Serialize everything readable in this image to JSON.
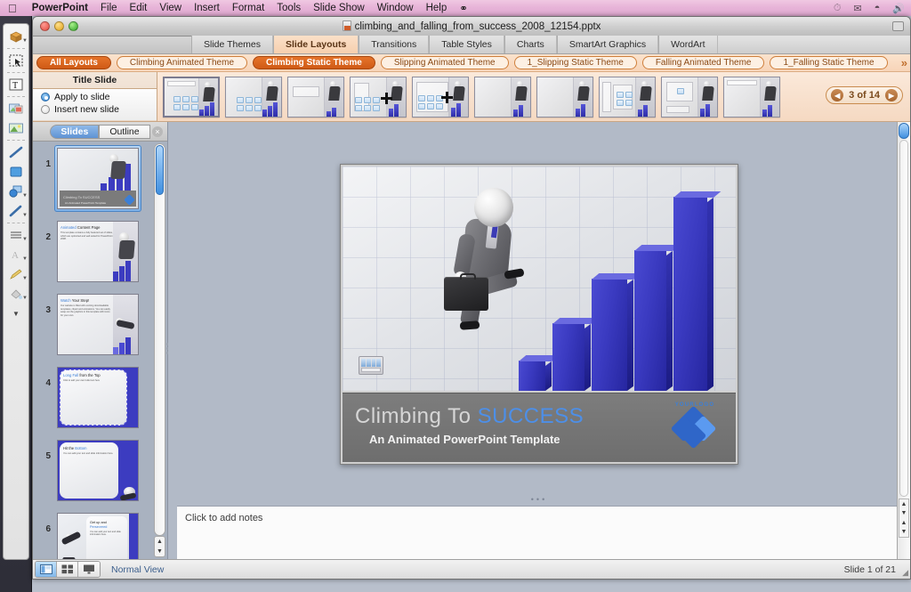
{
  "menubar": {
    "apple_icon": "apple-logo",
    "items": [
      "PowerPoint",
      "File",
      "Edit",
      "View",
      "Insert",
      "Format",
      "Tools",
      "Slide Show",
      "Window",
      "Help"
    ],
    "app_name": "PowerPoint",
    "extra_icon": "script-menu-icon",
    "status_icons": [
      "clock-icon",
      "bluetooth-icon",
      "wifi-icon",
      "volume-icon"
    ]
  },
  "window": {
    "title": "climbing_and_falling_from_success_2008_12154.pptx",
    "doc_icon": "pptx-file-icon",
    "close_label": "close",
    "minimize_label": "minimize",
    "zoom_label": "zoom"
  },
  "ribbon": {
    "tabs": [
      {
        "label": "Slide Themes",
        "active": false
      },
      {
        "label": "Slide Layouts",
        "active": true
      },
      {
        "label": "Transitions",
        "active": false
      },
      {
        "label": "Table Styles",
        "active": false
      },
      {
        "label": "Charts",
        "active": false
      },
      {
        "label": "SmartArt Graphics",
        "active": false
      },
      {
        "label": "WordArt",
        "active": false
      }
    ]
  },
  "theme_row": {
    "pills": [
      {
        "label": "All Layouts",
        "active": true
      },
      {
        "label": "Climbing Animated Theme",
        "active": false
      },
      {
        "label": "Climbing Static Theme",
        "active": true
      },
      {
        "label": "Slipping Animated Theme",
        "active": false
      },
      {
        "label": "1_Slipping Static Theme",
        "active": false
      },
      {
        "label": "Falling Animated Theme",
        "active": false
      },
      {
        "label": "1_Falling Static Theme",
        "active": false
      }
    ],
    "overflow_icon": "double-chevron-right-icon"
  },
  "gallery": {
    "title": "Title Slide",
    "apply_option": "Apply to slide",
    "insert_option": "Insert new slide",
    "selected_option": "Apply to slide",
    "pager": {
      "text": "3 of 14",
      "prev_icon": "chevron-left-icon",
      "next_icon": "chevron-right-icon"
    },
    "layouts": [
      {
        "name": "Title Slide",
        "selected": true
      },
      {
        "name": "Title and Content",
        "selected": false
      },
      {
        "name": "Section Header",
        "selected": false
      },
      {
        "name": "Two Content",
        "selected": false
      },
      {
        "name": "Comparison",
        "selected": false
      },
      {
        "name": "Title Only",
        "selected": false
      },
      {
        "name": "Blank",
        "selected": false
      },
      {
        "name": "Content with Caption",
        "selected": false
      },
      {
        "name": "Picture with Caption",
        "selected": false
      },
      {
        "name": "Title and Vertical Text",
        "selected": false
      }
    ]
  },
  "slides_panel": {
    "tab_slides": "Slides",
    "tab_outline": "Outline",
    "active_tab": "Slides",
    "close_icon": "close-panel-icon",
    "slides": [
      {
        "number": "1",
        "title": "Climbing To SUCCESS",
        "subtitle": "An Animated PowerPoint Template",
        "selected": true
      },
      {
        "number": "2",
        "title_accent": "Animated",
        "title_rest": " Content Page",
        "body": "This template contains a fully featured set of slides, which are optimized and well suited for PowerPoint 2008.",
        "selected": false
      },
      {
        "number": "3",
        "title_accent": "Watch",
        "title_rest": " Your Step!",
        "body": "Our website is filled with exciting downloadable templates, clipart and animations. You can easily swap out the graphics in this template with icons for your own.",
        "selected": false
      },
      {
        "number": "4",
        "title_accent": "Long Fall",
        "title_rest": " from the Top",
        "body": "Click to add your own bullet text here",
        "selected": false
      },
      {
        "number": "5",
        "title_accent": "Hit the",
        "title_rest": " Bottom",
        "body": "You can add your text and slide information here.",
        "selected": false
      },
      {
        "number": "6",
        "title_accent": "Get up and",
        "title_rest": " Persevered",
        "body": "You can add your text and slide information here.",
        "selected": false
      }
    ]
  },
  "slide": {
    "title_plain": "Climbing To ",
    "title_highlight": "SUCCESS",
    "subtitle": "An Animated PowerPoint Template",
    "logo_text": "YOURLOGO",
    "media_badge": "filmstrip-badge-icon",
    "accent_color": "#4d8fe8",
    "bar_color": "#3a3ac0"
  },
  "notes": {
    "placeholder": "Click to add notes",
    "value": ""
  },
  "statusbar": {
    "views": [
      {
        "name": "normal-view",
        "active": true
      },
      {
        "name": "slide-sorter-view",
        "active": false
      },
      {
        "name": "slide-show-view",
        "active": false
      }
    ],
    "view_label": "Normal View",
    "slide_count": "Slide 1 of 21"
  },
  "vtoolbar": {
    "tools": [
      {
        "name": "3d-object-tool",
        "glyph": "box",
        "caret": true
      },
      {
        "name": "selection-marquee-tool",
        "glyph": "marquee",
        "caret": false
      },
      {
        "name": "text-box-tool",
        "glyph": "text",
        "caret": false
      },
      {
        "name": "picture-tool",
        "glyph": "picture",
        "caret": false
      },
      {
        "name": "media-tool",
        "glyph": "media",
        "caret": false
      },
      {
        "name": "line-tool",
        "glyph": "line",
        "caret": false
      },
      {
        "name": "rectangle-tool",
        "glyph": "rect",
        "caret": false
      },
      {
        "name": "shapes-tool",
        "glyph": "shapes",
        "caret": true
      },
      {
        "name": "arrow-line-tool",
        "glyph": "pencilline",
        "caret": true
      },
      {
        "name": "align-tool",
        "glyph": "lines",
        "caret": true
      },
      {
        "name": "font-color-tool",
        "glyph": "A",
        "caret": true
      },
      {
        "name": "pen-tool",
        "glyph": "pen",
        "caret": true
      },
      {
        "name": "fill-tool",
        "glyph": "fill",
        "caret": true
      },
      {
        "name": "more-tools",
        "glyph": "caret",
        "caret": false
      }
    ]
  }
}
